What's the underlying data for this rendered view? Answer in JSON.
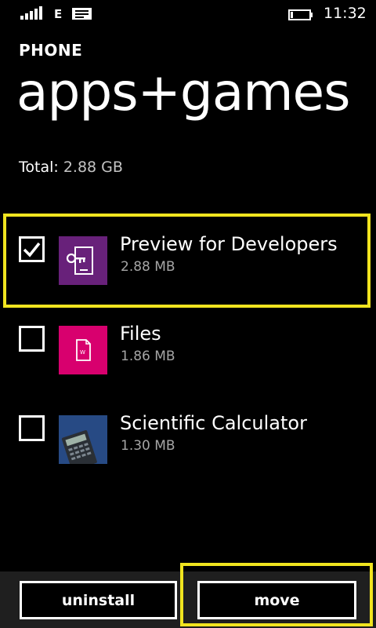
{
  "status_bar": {
    "network_type": "E",
    "time": "11:32",
    "icons": [
      "signal-strength-icon",
      "message-icon",
      "battery-icon"
    ]
  },
  "header": {
    "section": "PHONE",
    "title": "apps+games"
  },
  "storage": {
    "total_label": "Total:",
    "total_value": "2.88 GB"
  },
  "apps": [
    {
      "name": "Preview for Developers",
      "size": "2.88 MB",
      "checked": true,
      "icon": "preview-for-developers-icon",
      "tile_color": "#68217a"
    },
    {
      "name": "Files",
      "size": "1.86 MB",
      "checked": false,
      "icon": "files-icon",
      "tile_color": "#d8006e"
    },
    {
      "name": "Scientific Calculator",
      "size": "1.30 MB",
      "checked": false,
      "icon": "scientific-calculator-icon",
      "tile_color": "#1e3a6e"
    }
  ],
  "app_bar": {
    "uninstall_label": "uninstall",
    "move_label": "move"
  },
  "colors": {
    "background": "#000000",
    "highlight": "#f0e41f",
    "secondary_text": "#a5a5a5",
    "app_bar": "#1f1f1f"
  }
}
